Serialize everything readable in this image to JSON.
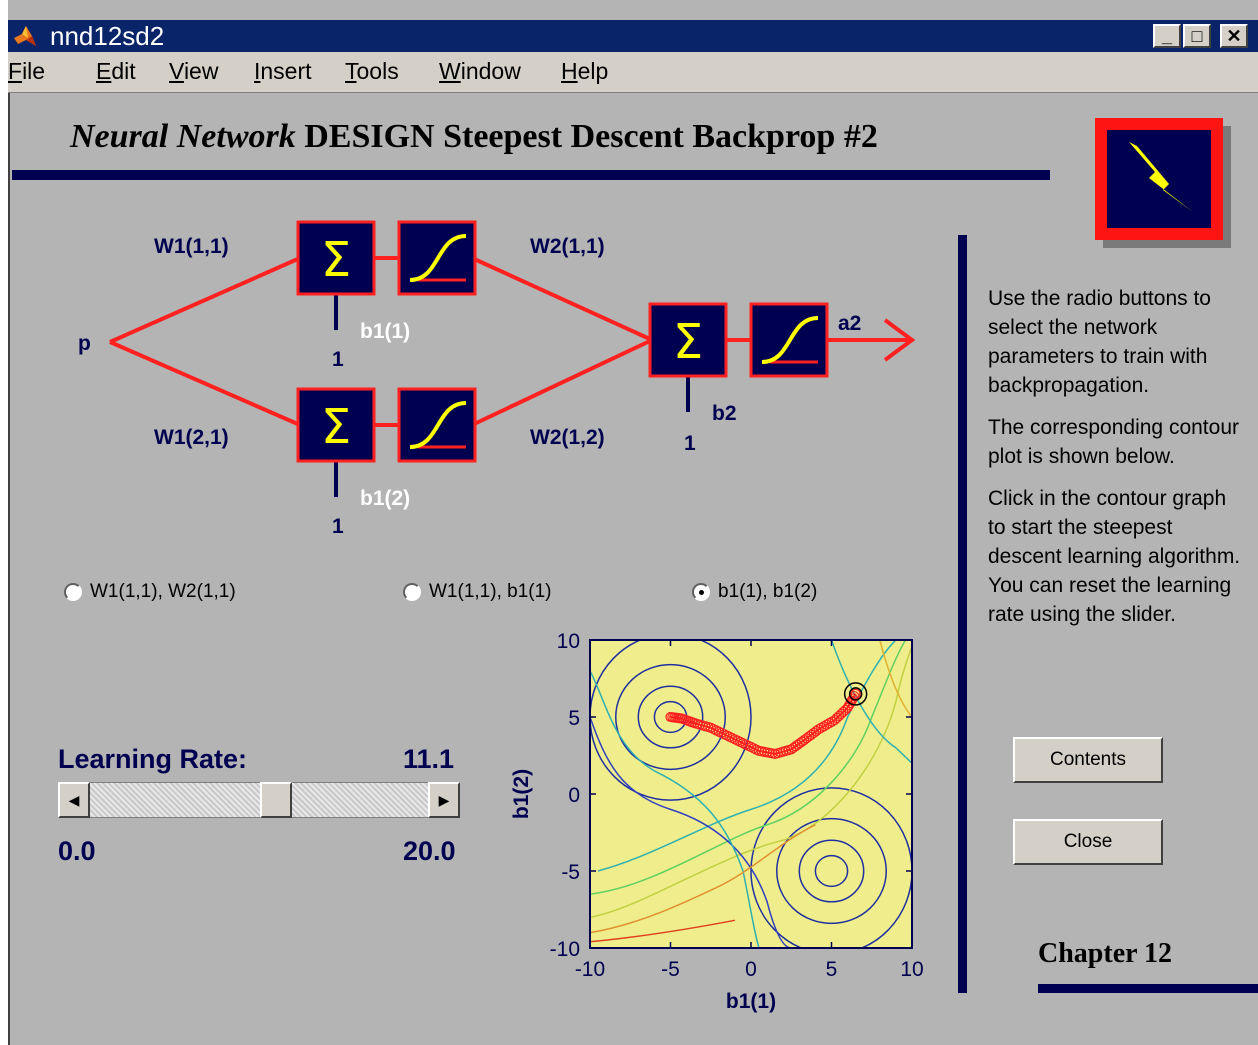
{
  "window": {
    "title": "nnd12sd2",
    "controls": {
      "minimize": "_",
      "maximize": "□",
      "close": "✕"
    }
  },
  "menu": [
    {
      "label": "File",
      "accel": "F",
      "rest": "ile"
    },
    {
      "label": "Edit",
      "accel": "E",
      "rest": "dit"
    },
    {
      "label": "View",
      "accel": "V",
      "rest": "iew"
    },
    {
      "label": "Insert",
      "accel": "I",
      "rest": "nsert"
    },
    {
      "label": "Tools",
      "accel": "T",
      "rest": "ools"
    },
    {
      "label": "Window",
      "accel": "W",
      "rest": "indow"
    },
    {
      "label": "Help",
      "accel": "H",
      "rest": "elp"
    }
  ],
  "header": {
    "title_italic": "Neural Network",
    "title_rest": "DESIGN Steepest Descent Backprop #2"
  },
  "network": {
    "input": "p",
    "output": "a2",
    "w11": "W1(1,1)",
    "w12": "W1(2,1)",
    "w21": "W2(1,1)",
    "w22": "W2(1,2)",
    "b11": "b1(1)",
    "b12": "b1(2)",
    "b2": "b2",
    "one": "1"
  },
  "radios": [
    {
      "label": "W1(1,1), W2(1,1)",
      "selected": false
    },
    {
      "label": "W1(1,1), b1(1)",
      "selected": false
    },
    {
      "label": "b1(1), b1(2)",
      "selected": true
    }
  ],
  "learning_rate": {
    "label": "Learning Rate:",
    "value": "11.1",
    "min": "0.0",
    "max": "20.0",
    "fraction": 0.555
  },
  "help": {
    "p1": "Use the radio buttons to select the network parameters to train with backpropagation.",
    "p2": "The corresponding contour plot is shown below.",
    "p3": "Click in the contour graph to start the steepest descent learning algorithm. You can reset the learning rate using the slider."
  },
  "buttons": {
    "contents": "Contents",
    "close": "Close"
  },
  "chapter": "Chapter 12",
  "chart_data": {
    "type": "contour",
    "xlabel": "b1(1)",
    "ylabel": "b1(2)",
    "xlim": [
      -10,
      10
    ],
    "ylim": [
      -10,
      10
    ],
    "xticks": [
      "-10",
      "-5",
      "0",
      "5",
      "10"
    ],
    "yticks": [
      "10",
      "5",
      "0",
      "-5",
      "-10"
    ],
    "minima": [
      [
        -5,
        5
      ],
      [
        5,
        -5
      ]
    ],
    "start_point": [
      6.5,
      6.5
    ],
    "trajectory": [
      [
        6.5,
        6.5
      ],
      [
        6.0,
        5.6
      ],
      [
        5.2,
        4.8
      ],
      [
        4.2,
        4.2
      ],
      [
        3.3,
        3.5
      ],
      [
        2.5,
        2.9
      ],
      [
        1.5,
        2.6
      ],
      [
        0.5,
        2.8
      ],
      [
        -0.5,
        3.3
      ],
      [
        -1.5,
        3.8
      ],
      [
        -2.5,
        4.3
      ],
      [
        -3.5,
        4.6
      ],
      [
        -4.3,
        4.9
      ],
      [
        -5.0,
        5.0
      ]
    ],
    "colors": {
      "background": "#f0ee8c",
      "path": "#ff2020"
    }
  }
}
